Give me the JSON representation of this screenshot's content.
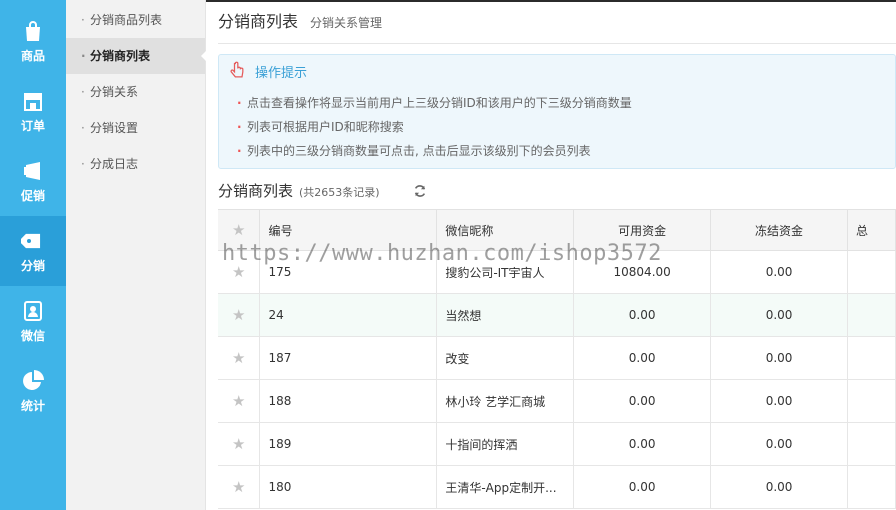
{
  "rail": [
    {
      "label": "商品",
      "icon": "bag-icon"
    },
    {
      "label": "订单",
      "icon": "store-icon"
    },
    {
      "label": "促销",
      "icon": "promo-icon"
    },
    {
      "label": "分销",
      "icon": "tag-icon",
      "active": true
    },
    {
      "label": "微信",
      "icon": "wechat-icon"
    },
    {
      "label": "统计",
      "icon": "pie-icon"
    }
  ],
  "subnav": [
    {
      "label": "分销商品列表"
    },
    {
      "label": "分销商列表",
      "active": true
    },
    {
      "label": "分销关系"
    },
    {
      "label": "分销设置"
    },
    {
      "label": "分成日志"
    }
  ],
  "header": {
    "title": "分销商列表",
    "subtitle": "分销关系管理"
  },
  "tips": {
    "title": "操作提示",
    "items": [
      "点击查看操作将显示当前用户上三级分销ID和该用户的下三级分销商数量",
      "列表可根据用户ID和昵称搜索",
      "列表中的三级分销商数量可点击, 点击后显示该级别下的会员列表"
    ]
  },
  "list": {
    "title": "分销商列表",
    "count_text": "(共2653条记录)"
  },
  "table": {
    "columns": [
      "编号",
      "微信昵称",
      "可用资金",
      "冻结资金",
      "总"
    ],
    "rows": [
      {
        "id": "175",
        "nickname": "搜豹公司-IT宇宙人",
        "available": "10804.00",
        "frozen": "0.00"
      },
      {
        "id": "24",
        "nickname": "当然想",
        "available": "0.00",
        "frozen": "0.00"
      },
      {
        "id": "187",
        "nickname": "改变",
        "available": "0.00",
        "frozen": "0.00"
      },
      {
        "id": "188",
        "nickname": "林小玲 艺学汇商城",
        "available": "0.00",
        "frozen": "0.00"
      },
      {
        "id": "189",
        "nickname": "十指间的挥洒",
        "available": "0.00",
        "frozen": "0.00"
      },
      {
        "id": "180",
        "nickname": "王清华-App定制开...",
        "available": "0.00",
        "frozen": "0.00"
      }
    ]
  },
  "watermark": "https://www.huzhan.com/ishop3572",
  "colors": {
    "rail": "#3fb4e8",
    "rail_active": "#2a9fd9",
    "accent": "#3aa0d6"
  }
}
